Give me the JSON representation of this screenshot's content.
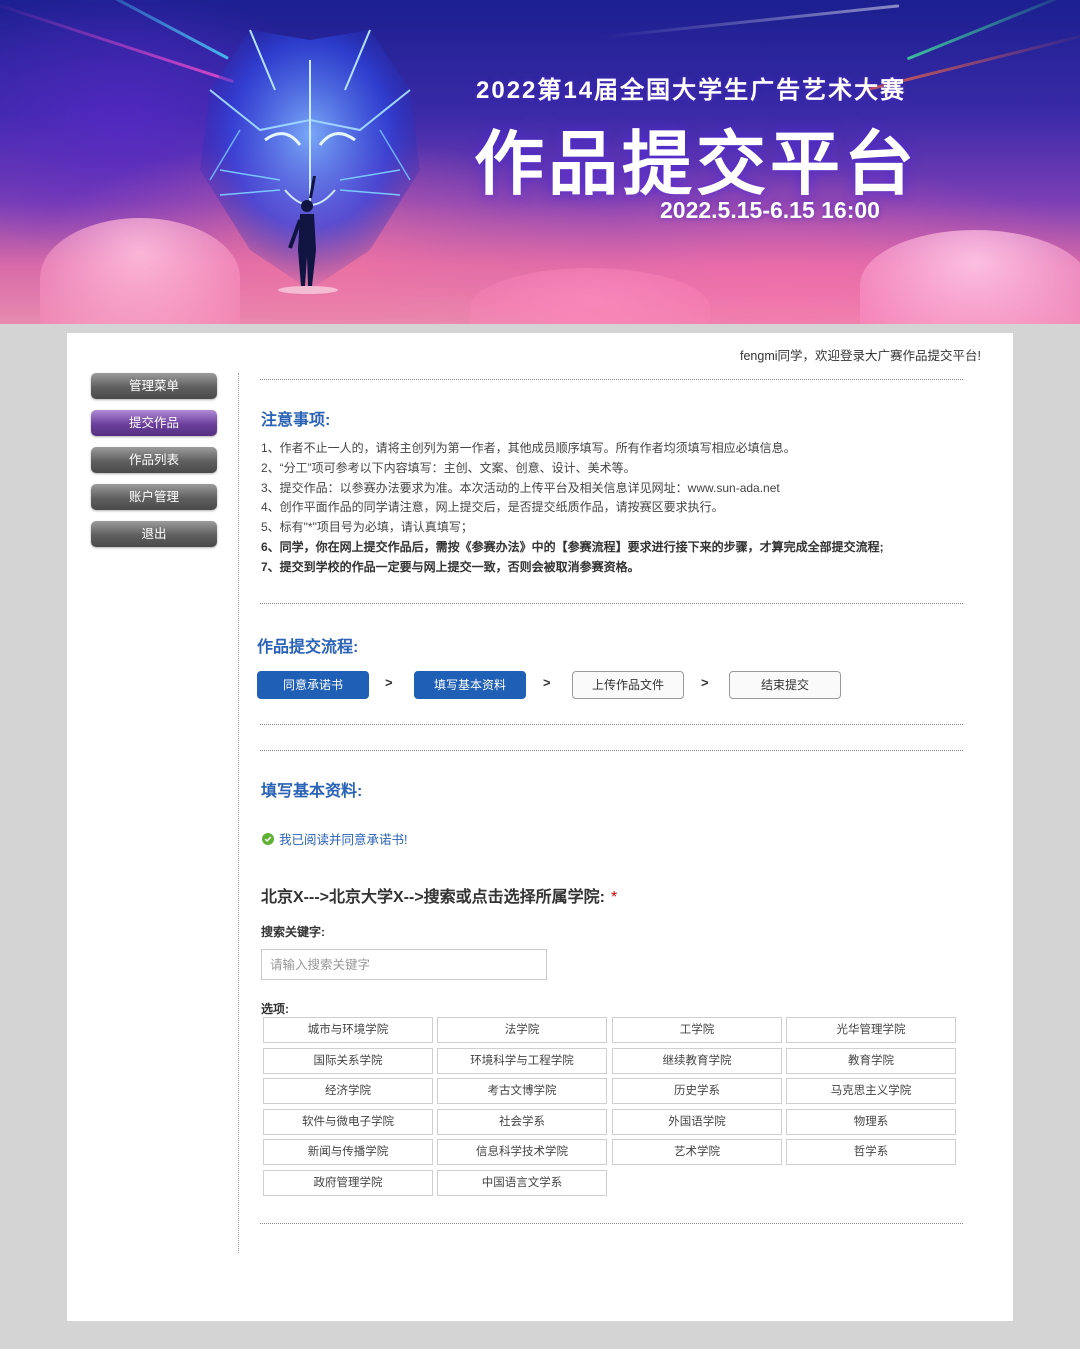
{
  "banner": {
    "subtitle": "2022第14届全国大学生广告艺术大赛",
    "title": "作品提交平台",
    "date": "2022.5.15-6.15 16:00"
  },
  "header": {
    "welcome": "fengmi同学，欢迎登录大广赛作品提交平台!"
  },
  "sidebar": {
    "items": [
      {
        "label": "管理菜单"
      },
      {
        "label": "提交作品"
      },
      {
        "label": "作品列表"
      },
      {
        "label": "账户管理"
      },
      {
        "label": "退出"
      }
    ],
    "active_index": 1
  },
  "notes": {
    "title": "注意事项:",
    "items": [
      "1、作者不止一人的，请将主创列为第一作者，其他成员顺序填写。所有作者均须填写相应必填信息。",
      "2、“分工”项可参考以下内容填写：主创、文案、创意、设计、美术等。",
      "3、提交作品：以参赛办法要求为准。本次活动的上传平台及相关信息详见网址：www.sun-ada.net",
      "4、创作平面作品的同学请注意，网上提交后，是否提交纸质作品，请按赛区要求执行。",
      "5、标有\"*\"项目号为必填，请认真填写；",
      "6、同学，你在网上提交作品后，需按《参赛办法》中的【参赛流程】要求进行接下来的步骤，才算完成全部提交流程;",
      "7、提交到学校的作品一定要与网上提交一致，否则会被取消参赛资格。"
    ]
  },
  "process": {
    "title": "作品提交流程:",
    "steps": [
      {
        "label": "同意承诺书",
        "state": "done"
      },
      {
        "label": "填写基本资料",
        "state": "current"
      },
      {
        "label": "上传作品文件",
        "state": "todo"
      },
      {
        "label": "结束提交",
        "state": "todo"
      }
    ],
    "arrow": ">"
  },
  "form": {
    "title": "填写基本资料:",
    "agree_text": "我已阅读并同意承诺书!",
    "path_text": "北京X--->北京大学X-->搜索或点击选择所属学院:",
    "required_mark": "*",
    "keyword_label": "搜索关键字:",
    "search_placeholder": "请输入搜索关键字",
    "search_value": "",
    "options_label": "选项:",
    "options": [
      "城市与环境学院",
      "法学院",
      "工学院",
      "光华管理学院",
      "国际关系学院",
      "环境科学与工程学院",
      "继续教育学院",
      "教育学院",
      "经济学院",
      "考古文博学院",
      "历史学系",
      "马克思主义学院",
      "软件与微电子学院",
      "社会学系",
      "外国语学院",
      "物理系",
      "新闻与传播学院",
      "信息科学技术学院",
      "艺术学院",
      "哲学系",
      "政府管理学院",
      "中国语言文学系"
    ]
  },
  "colors": {
    "accent": "#2a62b5",
    "step_active": "#1f5fb5",
    "menu_active": "#6b3f9c",
    "menu": "#5f5f5f",
    "required": "#d40000",
    "check": "#5fb133"
  }
}
